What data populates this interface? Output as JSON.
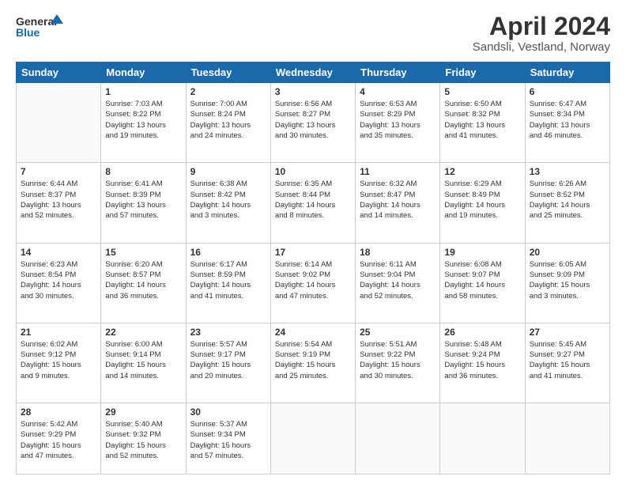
{
  "logo": {
    "line1": "General",
    "line2": "Blue"
  },
  "title": "April 2024",
  "location": "Sandsli, Vestland, Norway",
  "weekdays": [
    "Sunday",
    "Monday",
    "Tuesday",
    "Wednesday",
    "Thursday",
    "Friday",
    "Saturday"
  ],
  "weeks": [
    [
      {
        "day": "",
        "info": ""
      },
      {
        "day": "1",
        "info": "Sunrise: 7:03 AM\nSunset: 8:22 PM\nDaylight: 13 hours\nand 19 minutes."
      },
      {
        "day": "2",
        "info": "Sunrise: 7:00 AM\nSunset: 8:24 PM\nDaylight: 13 hours\nand 24 minutes."
      },
      {
        "day": "3",
        "info": "Sunrise: 6:56 AM\nSunset: 8:27 PM\nDaylight: 13 hours\nand 30 minutes."
      },
      {
        "day": "4",
        "info": "Sunrise: 6:53 AM\nSunset: 8:29 PM\nDaylight: 13 hours\nand 35 minutes."
      },
      {
        "day": "5",
        "info": "Sunrise: 6:50 AM\nSunset: 8:32 PM\nDaylight: 13 hours\nand 41 minutes."
      },
      {
        "day": "6",
        "info": "Sunrise: 6:47 AM\nSunset: 8:34 PM\nDaylight: 13 hours\nand 46 minutes."
      }
    ],
    [
      {
        "day": "7",
        "info": "Sunrise: 6:44 AM\nSunset: 8:37 PM\nDaylight: 13 hours\nand 52 minutes."
      },
      {
        "day": "8",
        "info": "Sunrise: 6:41 AM\nSunset: 8:39 PM\nDaylight: 13 hours\nand 57 minutes."
      },
      {
        "day": "9",
        "info": "Sunrise: 6:38 AM\nSunset: 8:42 PM\nDaylight: 14 hours\nand 3 minutes."
      },
      {
        "day": "10",
        "info": "Sunrise: 6:35 AM\nSunset: 8:44 PM\nDaylight: 14 hours\nand 8 minutes."
      },
      {
        "day": "11",
        "info": "Sunrise: 6:32 AM\nSunset: 8:47 PM\nDaylight: 14 hours\nand 14 minutes."
      },
      {
        "day": "12",
        "info": "Sunrise: 6:29 AM\nSunset: 8:49 PM\nDaylight: 14 hours\nand 19 minutes."
      },
      {
        "day": "13",
        "info": "Sunrise: 6:26 AM\nSunset: 8:52 PM\nDaylight: 14 hours\nand 25 minutes."
      }
    ],
    [
      {
        "day": "14",
        "info": "Sunrise: 6:23 AM\nSunset: 8:54 PM\nDaylight: 14 hours\nand 30 minutes."
      },
      {
        "day": "15",
        "info": "Sunrise: 6:20 AM\nSunset: 8:57 PM\nDaylight: 14 hours\nand 36 minutes."
      },
      {
        "day": "16",
        "info": "Sunrise: 6:17 AM\nSunset: 8:59 PM\nDaylight: 14 hours\nand 41 minutes."
      },
      {
        "day": "17",
        "info": "Sunrise: 6:14 AM\nSunset: 9:02 PM\nDaylight: 14 hours\nand 47 minutes."
      },
      {
        "day": "18",
        "info": "Sunrise: 6:11 AM\nSunset: 9:04 PM\nDaylight: 14 hours\nand 52 minutes."
      },
      {
        "day": "19",
        "info": "Sunrise: 6:08 AM\nSunset: 9:07 PM\nDaylight: 14 hours\nand 58 minutes."
      },
      {
        "day": "20",
        "info": "Sunrise: 6:05 AM\nSunset: 9:09 PM\nDaylight: 15 hours\nand 3 minutes."
      }
    ],
    [
      {
        "day": "21",
        "info": "Sunrise: 6:02 AM\nSunset: 9:12 PM\nDaylight: 15 hours\nand 9 minutes."
      },
      {
        "day": "22",
        "info": "Sunrise: 6:00 AM\nSunset: 9:14 PM\nDaylight: 15 hours\nand 14 minutes."
      },
      {
        "day": "23",
        "info": "Sunrise: 5:57 AM\nSunset: 9:17 PM\nDaylight: 15 hours\nand 20 minutes."
      },
      {
        "day": "24",
        "info": "Sunrise: 5:54 AM\nSunset: 9:19 PM\nDaylight: 15 hours\nand 25 minutes."
      },
      {
        "day": "25",
        "info": "Sunrise: 5:51 AM\nSunset: 9:22 PM\nDaylight: 15 hours\nand 30 minutes."
      },
      {
        "day": "26",
        "info": "Sunrise: 5:48 AM\nSunset: 9:24 PM\nDaylight: 15 hours\nand 36 minutes."
      },
      {
        "day": "27",
        "info": "Sunrise: 5:45 AM\nSunset: 9:27 PM\nDaylight: 15 hours\nand 41 minutes."
      }
    ],
    [
      {
        "day": "28",
        "info": "Sunrise: 5:42 AM\nSunset: 9:29 PM\nDaylight: 15 hours\nand 47 minutes."
      },
      {
        "day": "29",
        "info": "Sunrise: 5:40 AM\nSunset: 9:32 PM\nDaylight: 15 hours\nand 52 minutes."
      },
      {
        "day": "30",
        "info": "Sunrise: 5:37 AM\nSunset: 9:34 PM\nDaylight: 15 hours\nand 57 minutes."
      },
      {
        "day": "",
        "info": ""
      },
      {
        "day": "",
        "info": ""
      },
      {
        "day": "",
        "info": ""
      },
      {
        "day": "",
        "info": ""
      }
    ]
  ]
}
